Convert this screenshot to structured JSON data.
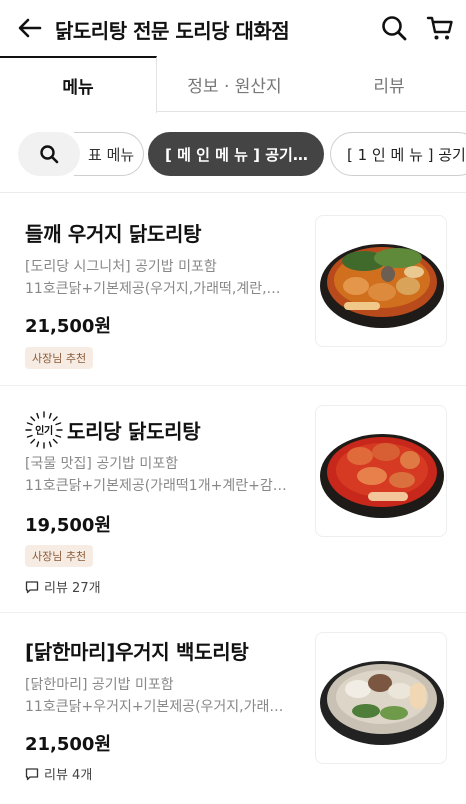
{
  "header": {
    "title": "닭도리탕 전문 도리당 대화점"
  },
  "tabs": [
    {
      "label": "메뉴",
      "active": true
    },
    {
      "label": "정보 · 원산지",
      "active": false
    },
    {
      "label": "리뷰",
      "active": false
    }
  ],
  "chips": [
    {
      "label": "⁣표 메뉴",
      "active": false
    },
    {
      "label": "[ 메 인 메 뉴 ] 공기…",
      "active": true
    },
    {
      "label": "[ 1 인 메 뉴 ] 공기",
      "active": false
    }
  ],
  "popular_icon_label": "인기",
  "menu_items": [
    {
      "name": "들깨 우거지 닭도리탕",
      "desc1": "[도리당 시그니처] 공기밥 미포함",
      "desc2": "11호큰닭+기본제공(우거지,가래떡,계란,…",
      "price": "21,500원",
      "badge": "사장님 추천",
      "review": ""
    },
    {
      "name": "도리당 닭도리탕",
      "desc1": "[국물 맛집] 공기밥 미포함",
      "desc2": "11호큰닭+기본제공(가래떡1개+계란+감…",
      "price": "19,500원",
      "badge": "사장님 추천",
      "review": "리뷰 27개"
    },
    {
      "name": "[닭한마리]우거지 백도리탕",
      "desc1": "[닭한마리]  공기밥 미포함",
      "desc2": "11호큰닭+우거지+기본제공(우거지,가래…",
      "price": "21,500원",
      "badge": "",
      "review": "리뷰 4개"
    }
  ],
  "colors": {
    "active_chip": "#444444",
    "badge_bg": "#f6ece3",
    "badge_text": "#8a5a38"
  }
}
